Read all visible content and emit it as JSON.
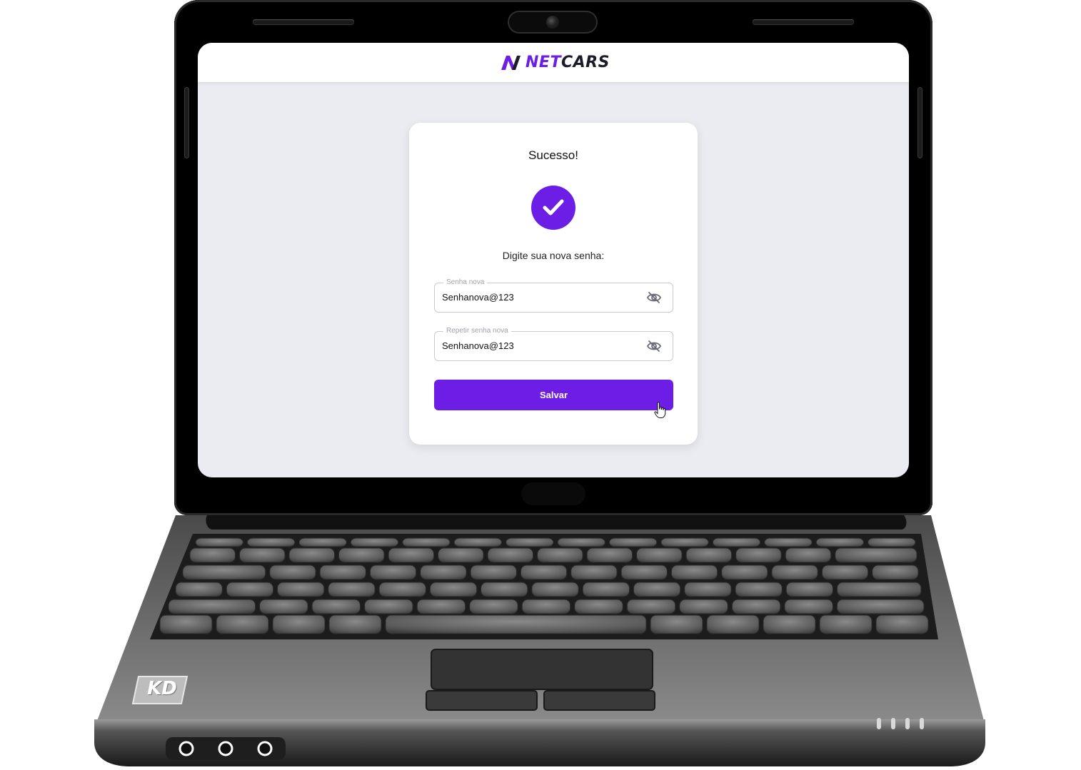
{
  "app": {
    "brand_net": "NET",
    "brand_cars": "CARS"
  },
  "card": {
    "title": "Sucesso!",
    "subtitle": "Digite sua nova senha:"
  },
  "fields": {
    "new_password": {
      "label": "Senha nova",
      "value": "Senhanova@123"
    },
    "repeat_password": {
      "label": "Repetir senha nova",
      "value": "Senhanova@123"
    }
  },
  "actions": {
    "save_label": "Salvar"
  },
  "device": {
    "brand_badge": "KD"
  },
  "colors": {
    "accent": "#6d1ee6",
    "background": "#ebecf1"
  },
  "icons": {
    "success": "check-circle-icon",
    "password_toggle": "eye-off-icon"
  }
}
